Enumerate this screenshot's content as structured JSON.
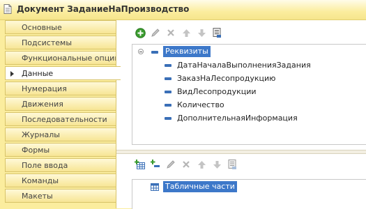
{
  "window": {
    "title": "Документ ЗаданиеНаПроизводство"
  },
  "sidebar": {
    "items": [
      {
        "label": "Основные"
      },
      {
        "label": "Подсистемы"
      },
      {
        "label": "Функциональные опции"
      },
      {
        "label": "Данные"
      },
      {
        "label": "Нумерация"
      },
      {
        "label": "Движения"
      },
      {
        "label": "Последовательности"
      },
      {
        "label": "Журналы"
      },
      {
        "label": "Формы"
      },
      {
        "label": "Поле ввода"
      },
      {
        "label": "Команды"
      },
      {
        "label": "Макеты"
      }
    ],
    "active": "Данные"
  },
  "attributes_tree": {
    "root_label": "Реквизиты",
    "children": [
      {
        "label": "ДатаНачалаВыполненияЗадания"
      },
      {
        "label": "ЗаказНаЛесопродукцию"
      },
      {
        "label": "ВидЛесопродукции"
      },
      {
        "label": "Количество"
      },
      {
        "label": "ДополнительнаяИнформация"
      }
    ]
  },
  "tables_tree": {
    "root_label": "Табличные части"
  },
  "icons": {
    "add": "add-icon",
    "edit": "pencil-icon",
    "delete": "delete-icon",
    "move_up": "arrow-up-icon",
    "move_down": "arrow-down-icon",
    "list": "list-icon",
    "add_table": "add-table-icon",
    "add_column": "add-column-icon"
  },
  "colors": {
    "background": "#fbed9e",
    "selection": "#3d78c9",
    "add_green": "#3a9b2e"
  }
}
